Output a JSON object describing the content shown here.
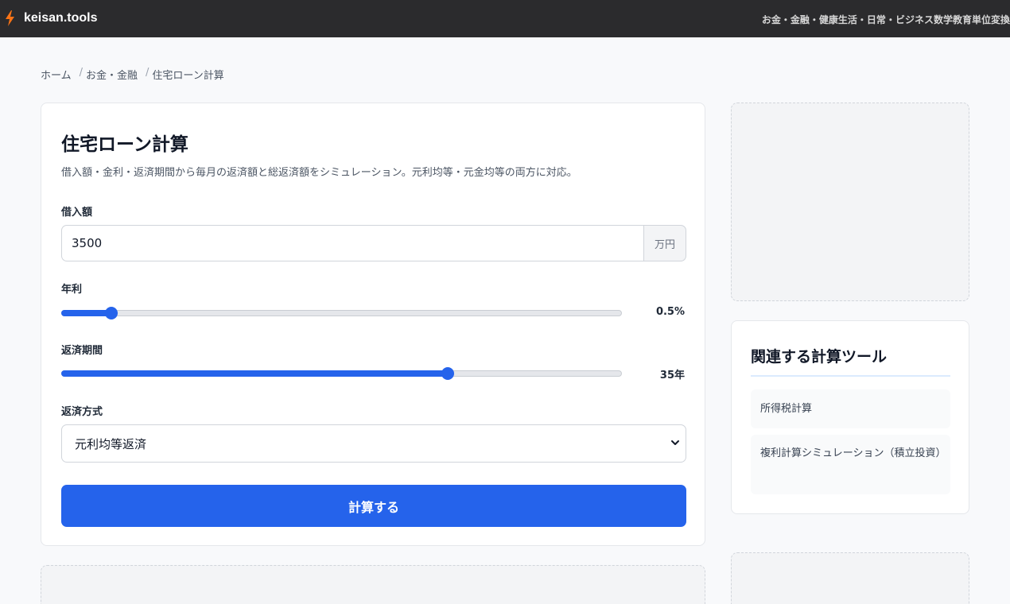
{
  "header": {
    "logo_text": "keisan.tools",
    "logo_icon": "lightning-bolt-icon",
    "nav": [
      "お金・金融",
      "健康",
      "生活・日常",
      "ビジネス",
      "数学",
      "教育",
      "単位変換"
    ]
  },
  "breadcrumb": [
    "ホーム",
    "お金・金融",
    "住宅ローン計算"
  ],
  "form": {
    "title": "住宅ローン計算",
    "description": "借入額・金利・返済期間から毎月の返済額と総返済額をシミュレーション。元利均等・元金均等の両方に対応。",
    "amount_label": "借入額",
    "amount_value": "3500",
    "amount_unit": "万円",
    "rate_label": "年利",
    "rate_value": "0.5%",
    "rate_fraction": 0.09,
    "period_label": "返済期間",
    "period_value": "35年",
    "period_fraction": 0.69,
    "method_label": "返済方式",
    "method_selected": "元利均等返済",
    "submit_label": "計算する"
  },
  "sidebar": {
    "related_title": "関連する計算ツール",
    "related_items": [
      "所得税計算",
      "複利計算シミュレーション（積立投資）"
    ]
  },
  "colors": {
    "accent": "#2563eb",
    "header_bg": "#2b2b2d",
    "logo_orange": "#f97316"
  }
}
